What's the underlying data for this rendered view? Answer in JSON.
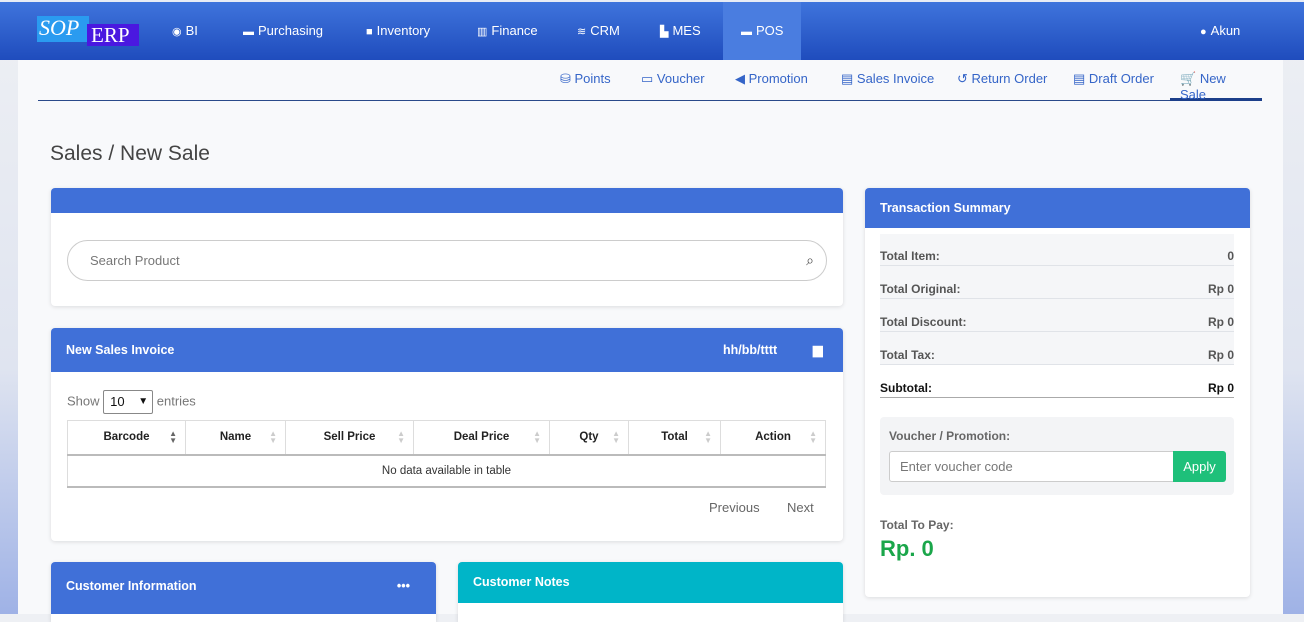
{
  "logo": {
    "part1": "SOP",
    "part2": "ERP"
  },
  "topnav": [
    {
      "label": "BI",
      "icon": "gauge-icon"
    },
    {
      "label": "Purchasing",
      "icon": "store-icon"
    },
    {
      "label": "Inventory",
      "icon": "box-icon"
    },
    {
      "label": "Finance",
      "icon": "bank-icon"
    },
    {
      "label": "CRM",
      "icon": "layers-icon"
    },
    {
      "label": "MES",
      "icon": "industry-icon"
    },
    {
      "label": "POS",
      "icon": "store-icon"
    }
  ],
  "account": "Akun",
  "subnav": [
    "Points",
    "Voucher",
    "Promotion",
    "Sales Invoice",
    "Return Order",
    "Draft Order",
    "New Sale"
  ],
  "page_title": "Sales / New Sale",
  "search": {
    "placeholder": "Search Product"
  },
  "invoice": {
    "title": "New Sales Invoice",
    "date_placeholder": "hh/bb/tttt",
    "show": "Show",
    "entries": "entries",
    "page_size": "10",
    "columns": [
      "Barcode",
      "Name",
      "Sell Price",
      "Deal Price",
      "Qty",
      "Total",
      "Action"
    ],
    "empty": "No data available in table",
    "previous": "Previous",
    "next": "Next"
  },
  "customer_info": {
    "title": "Customer Information",
    "menu": "•••"
  },
  "customer_notes": {
    "title": "Customer Notes"
  },
  "summary": {
    "title": "Transaction Summary",
    "rows": [
      {
        "label": "Total Item:",
        "value": "0"
      },
      {
        "label": "Total Original:",
        "value": "Rp 0"
      },
      {
        "label": "Total Discount:",
        "value": "Rp 0"
      },
      {
        "label": "Total Tax:",
        "value": "Rp 0"
      },
      {
        "label": "Subtotal:",
        "value": "Rp 0"
      }
    ],
    "voucher_label": "Voucher / Promotion:",
    "voucher_placeholder": "Enter voucher code",
    "apply": "Apply",
    "total_label": "Total To Pay:",
    "total_value": "Rp. 0"
  }
}
